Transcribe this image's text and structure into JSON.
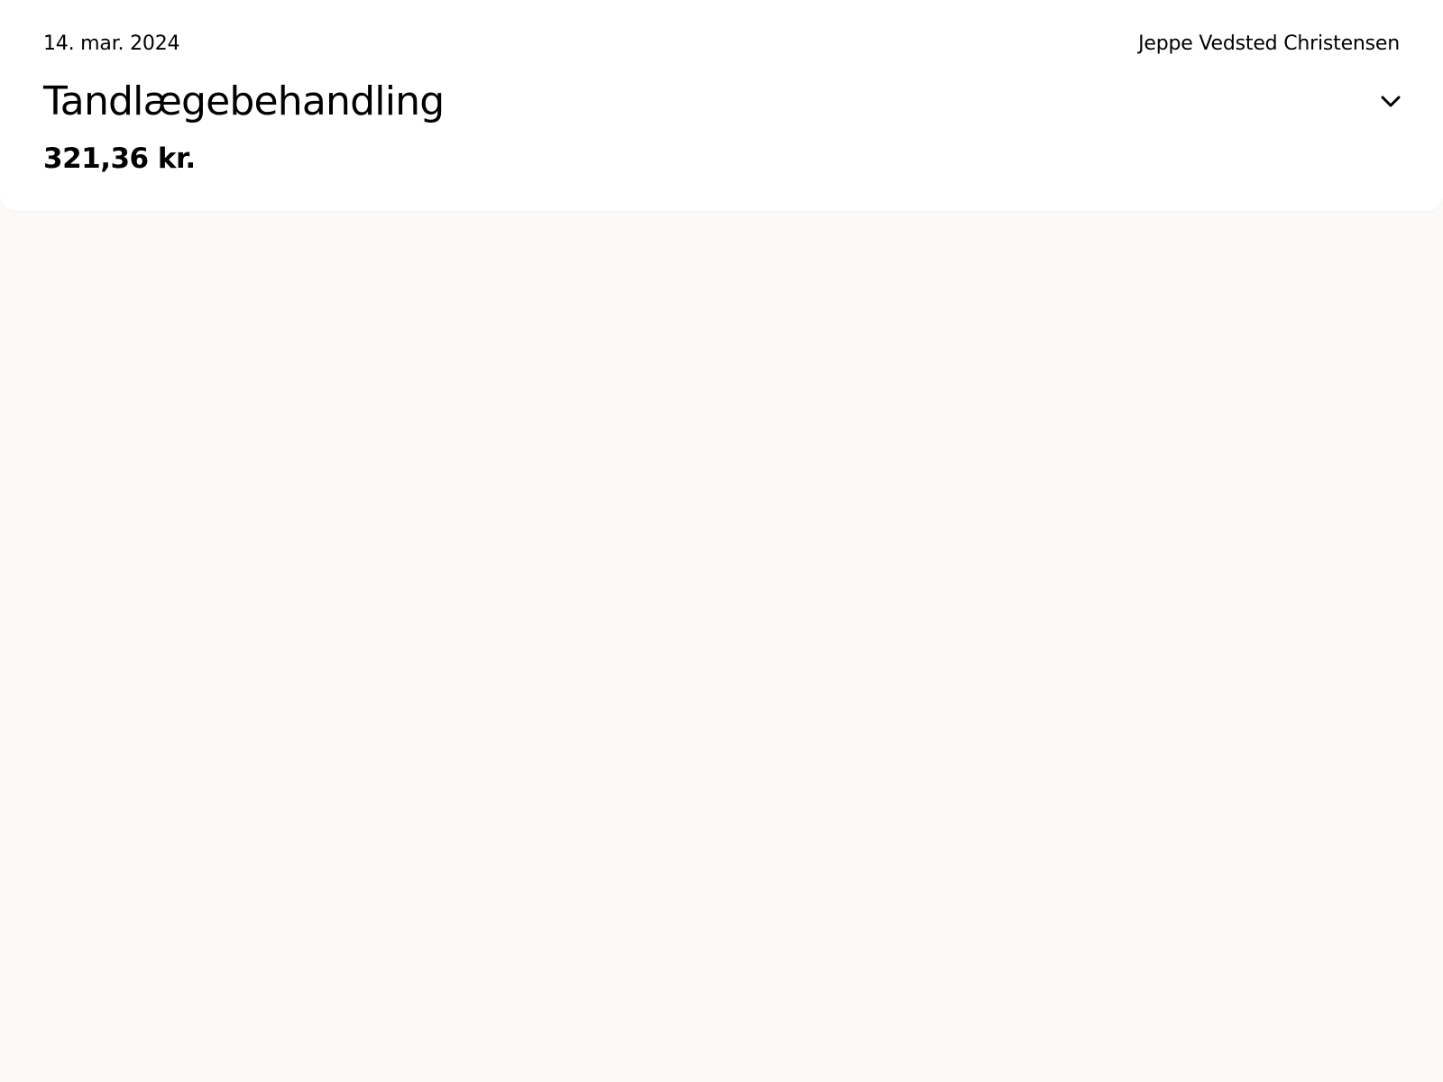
{
  "transaction": {
    "date": "14. mar. 2024",
    "person": "Jeppe Vedsted Christensen",
    "title": "Tandlægebehandling",
    "amount": "321,36 kr.",
    "expand_icon": "chevron-down-icon"
  },
  "colors": {
    "background": "#fbfaf8",
    "card": "#ffffff",
    "text": "#000000"
  }
}
